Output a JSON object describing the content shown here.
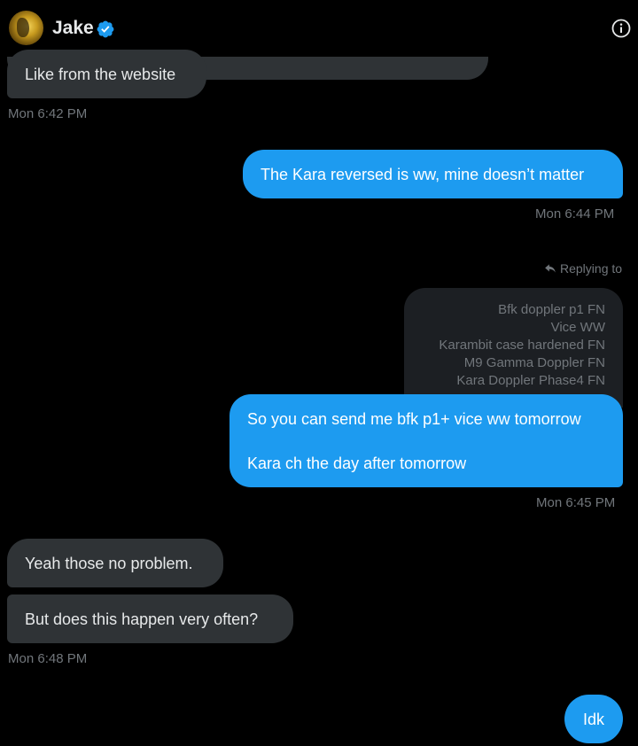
{
  "header": {
    "name": "Jake",
    "verified_icon": "verified-badge-icon",
    "info_icon": "info-icon"
  },
  "colors": {
    "background": "#000000",
    "incoming_bubble": "#2f3336",
    "outgoing_bubble": "#1d9bf0",
    "timestamp": "#71767b",
    "quoted_bg": "#1c1f23"
  },
  "messages": {
    "m1": {
      "text": "Like from the website",
      "time": "Mon 6:42 PM"
    },
    "m2": {
      "text": "The Kara reversed is ww, mine doesn’t matter",
      "time": "Mon 6:44 PM"
    },
    "reply": {
      "label": "Replying to",
      "quoted_lines": [
        "Bfk doppler p1 FN",
        "Vice WW",
        "Karambit case hardened FN",
        "M9 Gamma Doppler FN",
        "Kara Doppler Phase4 FN"
      ]
    },
    "m3": {
      "line1": "So you can send me bfk p1+ vice ww tomorrow",
      "line2": "Kara ch the day after tomorrow",
      "time": "Mon 6:45 PM"
    },
    "m4": {
      "text": "Yeah those no problem."
    },
    "m5": {
      "text": "But does this happen very often?",
      "time": "Mon 6:48 PM"
    },
    "m6": {
      "text": "Idk"
    }
  }
}
